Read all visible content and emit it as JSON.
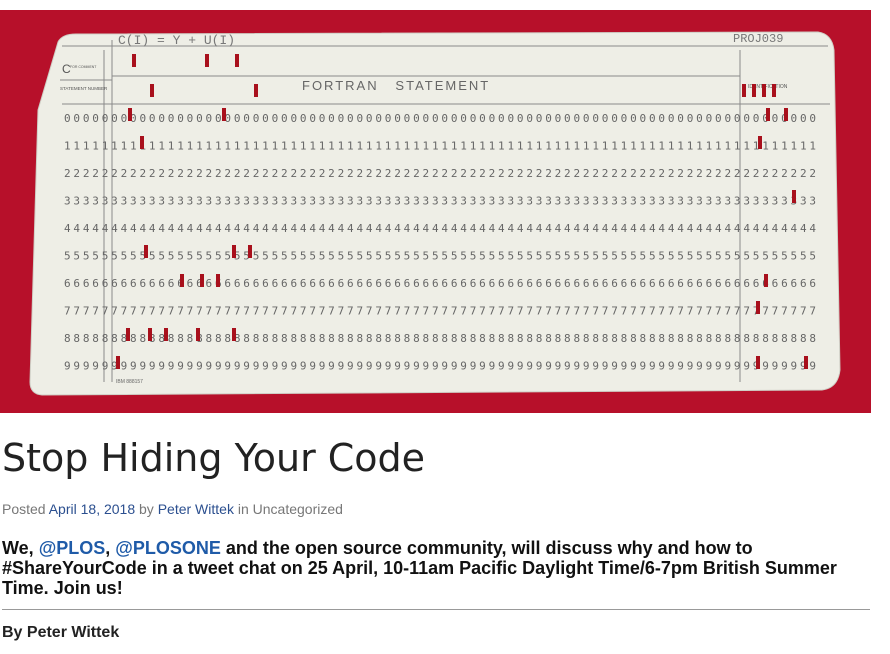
{
  "card": {
    "header_formula": "C(I) = Y + U(I)",
    "card_id": "PROJ039",
    "c_label": "C",
    "c_sublabel": "FOR COMMENT",
    "statement_label": "STATEMENT NUMBER",
    "fortran_label": "FORTRAN   STATEMENT",
    "ident_label": "IDENTIFICATION",
    "ibm_label": "IBM 888157",
    "digit_rows": [
      "0",
      "1",
      "2",
      "3",
      "4",
      "5",
      "6",
      "7",
      "8",
      "9"
    ],
    "colors": {
      "background": "#b7102a",
      "card": "#eeeee6",
      "punch": "#a8101c",
      "print": "#666666"
    }
  },
  "post": {
    "title": "Stop Hiding Your Code",
    "posted_prefix": "Posted",
    "date": "April 18, 2018",
    "by_prefix": "by",
    "author": "Peter Wittek",
    "in_prefix": "in",
    "category": "Uncategorized",
    "lead": {
      "part1": "We, ",
      "link1": "@PLOS",
      "sep": ", ",
      "link2": "@PLOSONE",
      "part2": " and the open source community, will discuss why and how to #ShareYourCode in a tweet chat on 25 April, 10-11am Pacific Daylight Time/6-7pm British Summer Time. Join us!"
    },
    "byline": "By Peter Wittek"
  }
}
